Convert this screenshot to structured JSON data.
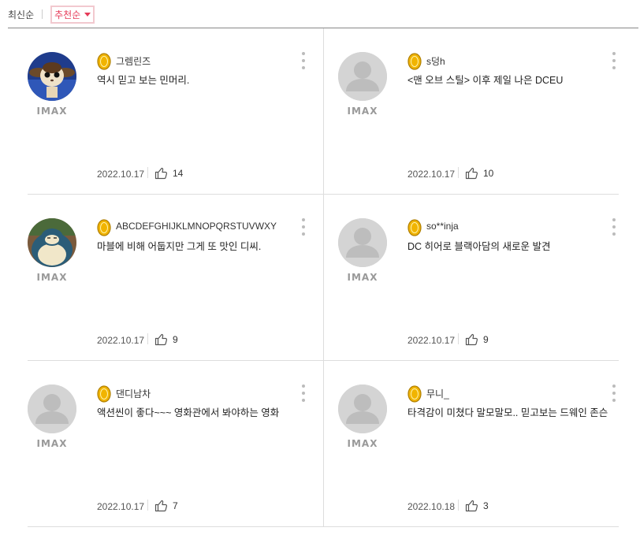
{
  "sort": {
    "latest": "최신순",
    "recommended": "추천순"
  },
  "format_label": "IMAX",
  "colors": {
    "accent": "#e63a58",
    "medal": "#f1b400"
  },
  "reviews": [
    {
      "name": "그렘린즈",
      "comment": "역시 믿고 보는 민머리.",
      "date": "2022.10.17",
      "likes": "14",
      "avatar": "gremlin-photo"
    },
    {
      "name": "s덩h",
      "comment": "<맨 오브 스틸> 이후 제일 나은 DCEU",
      "date": "2022.10.17",
      "likes": "10",
      "avatar": "default-user-icon"
    },
    {
      "name": "ABCDEFGHIJKLMNOPQRSTUVWXY",
      "comment": "마블에 비해 어둡지만 그게 또 맛인 디씨.",
      "date": "2022.10.17",
      "likes": "9",
      "avatar": "snorlax-photo"
    },
    {
      "name": "so**inja",
      "comment": "DC 히어로 블랙아담의 새로운 발견",
      "date": "2022.10.17",
      "likes": "9",
      "avatar": "default-user-icon"
    },
    {
      "name": "댄디남차",
      "comment": "액션씬이 좋다~~~ 영화관에서 봐야하는 영화",
      "date": "2022.10.17",
      "likes": "7",
      "avatar": "default-user-icon"
    },
    {
      "name": "무니_",
      "comment": "타격감이 미쳤다 말모말모.. 믿고보는 드웨인 존슨",
      "date": "2022.10.18",
      "likes": "3",
      "avatar": "default-user-icon"
    }
  ]
}
